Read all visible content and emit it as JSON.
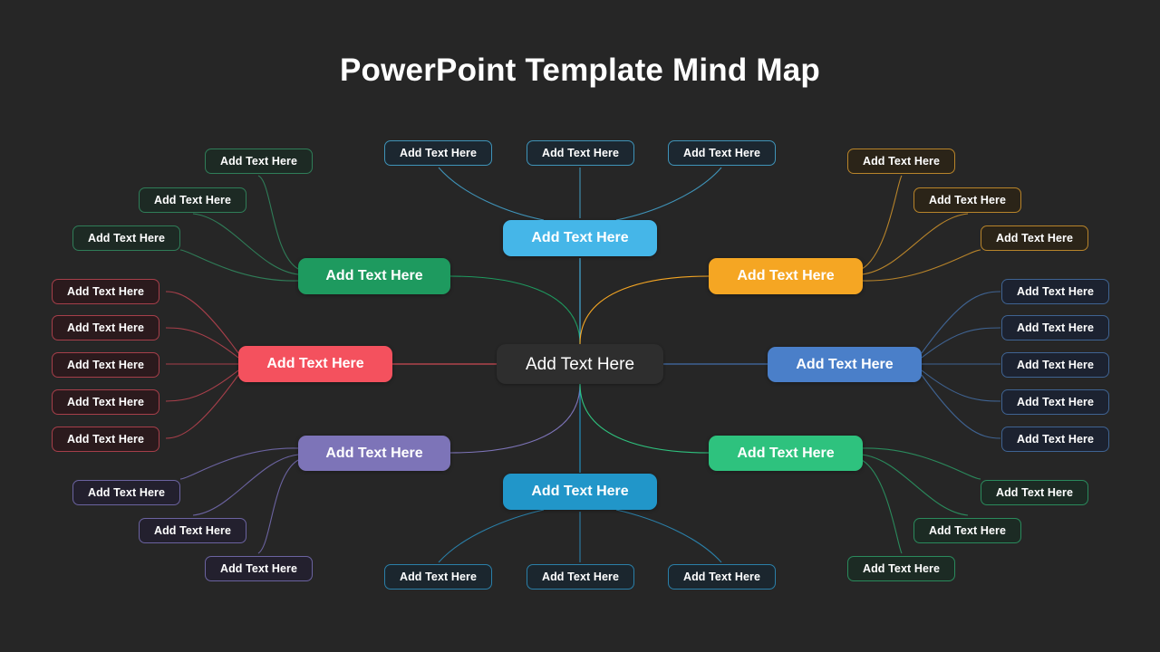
{
  "page": {
    "title": "PowerPoint Template Mind Map",
    "background": "#262626"
  },
  "palette": {
    "hub": "#2e2e2e",
    "green": "#1e9a5f",
    "red": "#f4515e",
    "purple": "#7d74b8",
    "sky": "#45b6e8",
    "teal": "#2196c9",
    "orange": "#f5a623",
    "blue": "#4a7fc9",
    "emerald": "#2ec27e"
  },
  "hub": {
    "label": "Add Text Here"
  },
  "branches": [
    {
      "id": "green",
      "label": "Add Text Here",
      "color": "#1e9a5f"
    },
    {
      "id": "red",
      "label": "Add Text Here",
      "color": "#f4515e"
    },
    {
      "id": "purple",
      "label": "Add Text Here",
      "color": "#7d74b8"
    },
    {
      "id": "sky",
      "label": "Add Text Here",
      "color": "#45b6e8"
    },
    {
      "id": "teal",
      "label": "Add Text Here",
      "color": "#2196c9"
    },
    {
      "id": "orange",
      "label": "Add Text Here",
      "color": "#f5a623"
    },
    {
      "id": "blue",
      "label": "Add Text Here",
      "color": "#4a7fc9"
    },
    {
      "id": "emerald",
      "label": "Add Text Here",
      "color": "#2ec27e"
    }
  ],
  "leaves": {
    "green": [
      "Add Text Here",
      "Add Text Here",
      "Add Text Here"
    ],
    "sky": [
      "Add Text Here",
      "Add Text Here",
      "Add Text Here"
    ],
    "orange": [
      "Add Text Here",
      "Add Text Here",
      "Add Text Here"
    ],
    "red": [
      "Add Text Here",
      "Add Text Here",
      "Add Text Here",
      "Add Text Here",
      "Add Text Here"
    ],
    "blue": [
      "Add Text Here",
      "Add Text Here",
      "Add Text Here",
      "Add Text Here",
      "Add Text Here"
    ],
    "purple": [
      "Add Text Here",
      "Add Text Here",
      "Add Text Here"
    ],
    "teal": [
      "Add Text Here",
      "Add Text Here",
      "Add Text Here"
    ],
    "emerald": [
      "Add Text Here",
      "Add Text Here",
      "Add Text Here"
    ]
  }
}
